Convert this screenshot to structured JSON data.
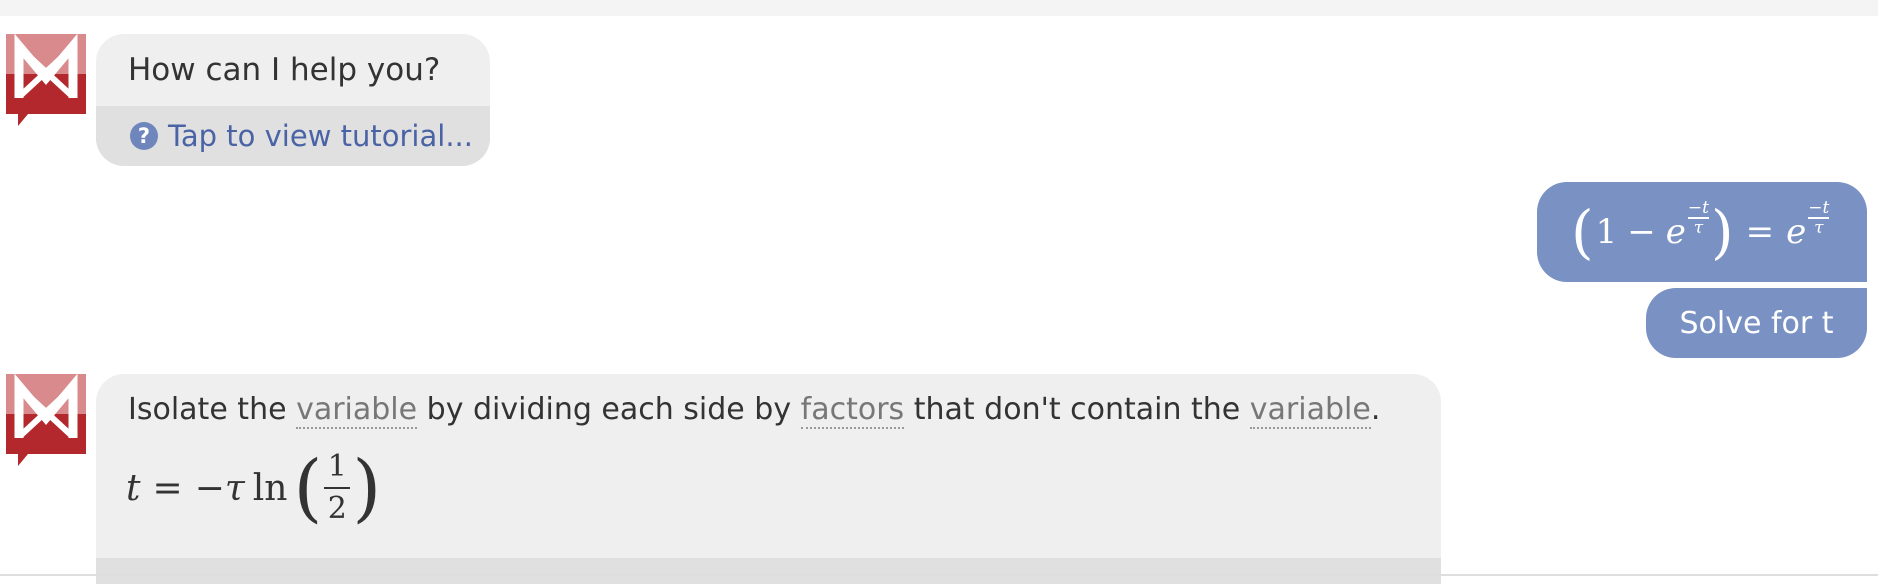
{
  "bot_intro": {
    "greeting": "How can I help you?",
    "tutorial_link": "Tap to view tutorial...",
    "help_glyph": "?"
  },
  "user_message": {
    "equation": {
      "open_paren": "(",
      "one": "1",
      "minus": "−",
      "e_left": "e",
      "exp_num_left": "−t",
      "exp_den_left": "τ",
      "close_paren": ")",
      "equals": "=",
      "e_right": "e",
      "exp_num_right": "−t",
      "exp_den_right": "τ"
    },
    "command": "Solve for t"
  },
  "bot_answer": {
    "text_1": "Isolate the ",
    "term_1": "variable",
    "text_2": " by dividing each side by ",
    "term_2": "factors",
    "text_3": " that don't contain the ",
    "term_3": "variable",
    "text_4": ".",
    "result": {
      "lhs": "t",
      "equals": "=",
      "minus": "−",
      "tau": "τ",
      "ln": "ln",
      "open_paren": "(",
      "numerator": "1",
      "denominator": "2",
      "close_paren": ")"
    }
  },
  "colors": {
    "brand_red": "#b3282d",
    "brand_red_light": "#d98a8c",
    "user_bubble": "#7a91c4",
    "bot_bubble": "#efefef",
    "link": "#4a63a6"
  },
  "icons": [
    "mathway-logo-icon",
    "question-circle-icon"
  ]
}
